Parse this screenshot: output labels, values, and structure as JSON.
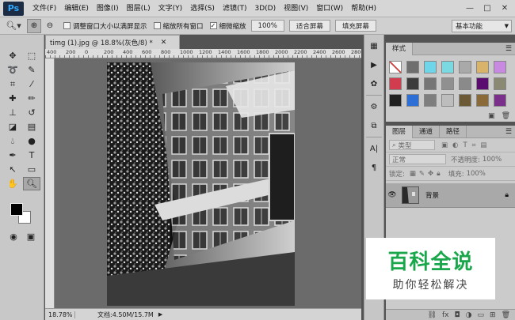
{
  "app": {
    "logo": "Ps"
  },
  "menu": [
    "文件(F)",
    "编辑(E)",
    "图像(I)",
    "图层(L)",
    "文字(Y)",
    "选择(S)",
    "滤镜(T)",
    "3D(D)",
    "视图(V)",
    "窗口(W)",
    "帮助(H)"
  ],
  "window_controls": {
    "minimize": "—",
    "restore": "□",
    "close": "✕"
  },
  "options": {
    "resize_windows_label": "调整窗口大小以满屏显示",
    "zoom_all_label": "缩放所有窗口",
    "scrubby_zoom_label": "细微缩放",
    "scrubby_zoom_checked": true,
    "btn_100": "100%",
    "btn_fit": "适合屏幕",
    "btn_fill": "填充屏幕",
    "workspace": "基本功能"
  },
  "document": {
    "tab_title": "timg (1).jpg @ 18.8%(灰色/8) *",
    "ruler_labels": [
      "400",
      "200",
      "0",
      "200",
      "400",
      "600",
      "800",
      "1000",
      "1200",
      "1400",
      "1600",
      "1800",
      "2000",
      "2200",
      "2400",
      "2600",
      "2800"
    ]
  },
  "status": {
    "zoom": "18.78%",
    "doc_size": "文档:4.50M/15.7M"
  },
  "panels": {
    "styles_tab": "样式",
    "layers_tabs": [
      "图层",
      "通道",
      "路径"
    ],
    "filter_kind": "类型",
    "blend_mode": "正常",
    "opacity_label": "不透明度:",
    "opacity_value": "100%",
    "lock_label": "锁定:",
    "fill_label": "填充:",
    "fill_value": "100%",
    "layer_name": "背景"
  },
  "style_swatches": [
    "#ffffff",
    "#6e6e6e",
    "#6fd5e8",
    "#7bd9e2",
    "#a9a9a9",
    "#d9b36a",
    "#c78ae0",
    "#d23c4f",
    "#3c3c3c",
    "#767676",
    "#909090",
    "#8a8a8a",
    "#5a0d6e",
    "#8a8a74",
    "#202020",
    "#2e6fd6",
    "#7e7e7e",
    "#bdbdbd",
    "#6b5a35",
    "#8a6a38",
    "#7a2f8a"
  ],
  "watermark": {
    "title": "百科全说",
    "subtitle": "助你轻松解决"
  }
}
